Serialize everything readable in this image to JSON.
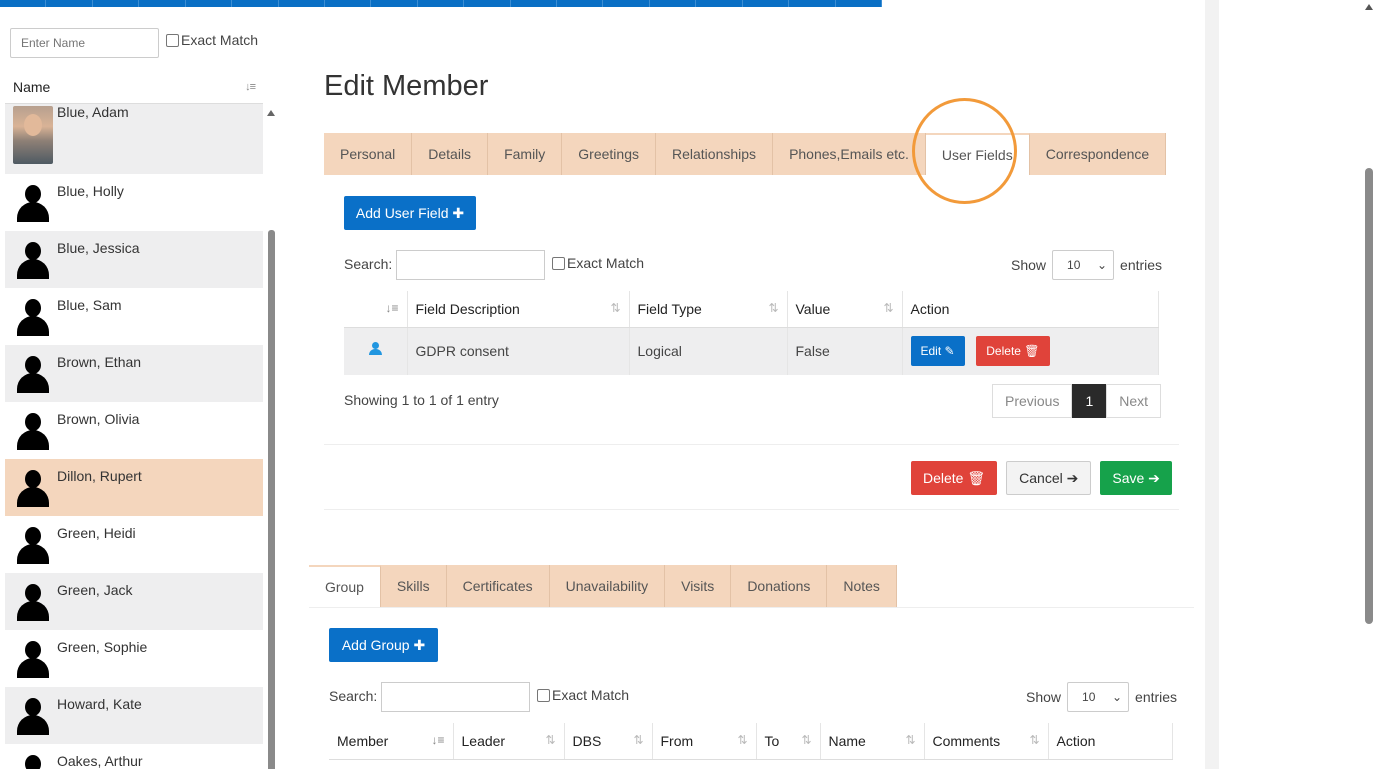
{
  "left_panel": {
    "search_placeholder": "Enter Name",
    "exact_match_label": "Exact Match",
    "column_header": "Name",
    "members": [
      {
        "name": "Blue, Adam",
        "style": "alt",
        "photo": true
      },
      {
        "name": "Blue, Holly",
        "style": "plain"
      },
      {
        "name": "Blue, Jessica",
        "style": "alt"
      },
      {
        "name": "Blue, Sam",
        "style": "plain"
      },
      {
        "name": "Brown, Ethan",
        "style": "alt"
      },
      {
        "name": "Brown, Olivia",
        "style": "plain"
      },
      {
        "name": "Dillon, Rupert",
        "style": "selected"
      },
      {
        "name": "Green, Heidi",
        "style": "plain"
      },
      {
        "name": "Green, Jack",
        "style": "alt"
      },
      {
        "name": "Green, Sophie",
        "style": "plain"
      },
      {
        "name": "Howard, Kate",
        "style": "alt"
      },
      {
        "name": "Oakes, Arthur",
        "style": "plain"
      }
    ]
  },
  "main": {
    "title": "Edit Member",
    "top_tabs": [
      {
        "label": "Personal",
        "active": false
      },
      {
        "label": "Details",
        "active": false
      },
      {
        "label": "Family",
        "active": false
      },
      {
        "label": "Greetings",
        "active": false
      },
      {
        "label": "Relationships",
        "active": false
      },
      {
        "label": "Phones,Emails etc.",
        "active": false
      },
      {
        "label": "User Fields",
        "active": true
      },
      {
        "label": "Correspondence",
        "active": false
      }
    ],
    "user_fields": {
      "add_button": "Add User Field",
      "search_label": "Search:",
      "exact_match_label": "Exact Match",
      "show_label": "Show",
      "entries_value": "10",
      "entries_label": "entries",
      "columns": [
        "",
        "Field Description",
        "Field Type",
        "Value",
        "Action"
      ],
      "rows": [
        {
          "description": "GDPR consent",
          "type": "Logical",
          "value": "False",
          "edit_label": "Edit",
          "delete_label": "Delete"
        }
      ],
      "showing_text": "Showing 1 to 1 of 1 entry",
      "pager": {
        "previous": "Previous",
        "current": "1",
        "next": "Next"
      }
    },
    "form_actions": {
      "delete": "Delete",
      "cancel": "Cancel",
      "save": "Save"
    },
    "bottom_tabs": [
      {
        "label": "Group",
        "active": true
      },
      {
        "label": "Skills",
        "active": false
      },
      {
        "label": "Certificates",
        "active": false
      },
      {
        "label": "Unavailability",
        "active": false
      },
      {
        "label": "Visits",
        "active": false
      },
      {
        "label": "Donations",
        "active": false
      },
      {
        "label": "Notes",
        "active": false
      }
    ],
    "group": {
      "add_button": "Add Group",
      "search_label": "Search:",
      "exact_match_label": "Exact Match",
      "show_label": "Show",
      "entries_value": "10",
      "entries_label": "entries",
      "columns": [
        "Member",
        "Leader",
        "DBS",
        "From",
        "To",
        "Name",
        "Comments",
        "Action"
      ]
    }
  },
  "colors": {
    "accent": "#0a70c8",
    "tab_bg": "#f4d6bd",
    "danger": "#e0433a",
    "success": "#16a24b",
    "highlight": "#f29a3a"
  }
}
